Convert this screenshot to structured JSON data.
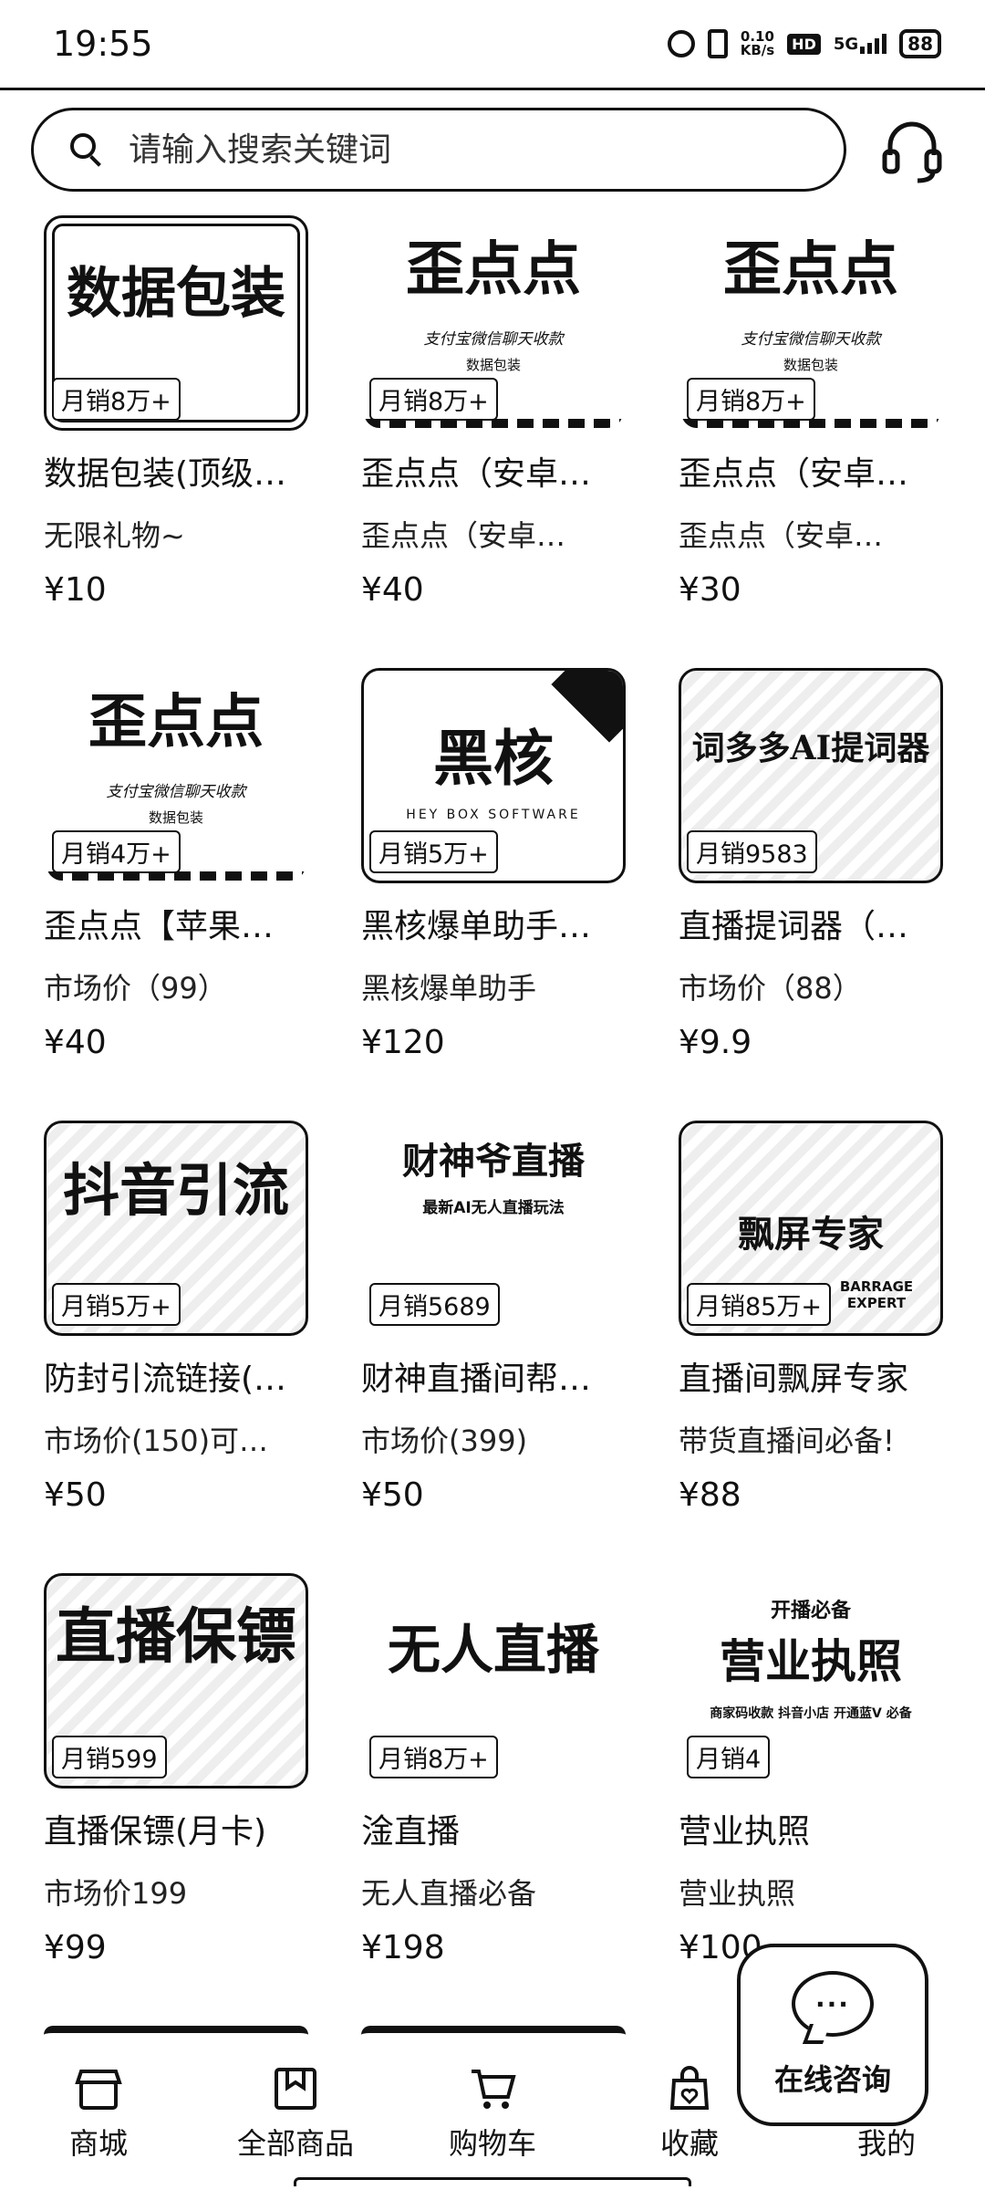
{
  "status_bar": {
    "time": "19:55",
    "net_speed_value": "0.10",
    "net_speed_unit": "KB/s",
    "hd": "HD",
    "signal": "5G",
    "battery": "88"
  },
  "search": {
    "placeholder": "请输入搜索关键词"
  },
  "products": [
    {
      "art": "数据包装",
      "art_sub": "",
      "art_sub2": "",
      "sales": "月销8万+",
      "name": "数据包装(顶级…",
      "desc": "无限礼物~",
      "price": "¥10"
    },
    {
      "art": "歪点点",
      "art_sub": "支付宝微信聊天收款",
      "art_sub2": "数据包装",
      "sales": "月销8万+",
      "name": "歪点点（安卓…",
      "desc": "歪点点（安卓…",
      "price": "¥40"
    },
    {
      "art": "歪点点",
      "art_sub": "支付宝微信聊天收款",
      "art_sub2": "数据包装",
      "sales": "月销8万+",
      "name": "歪点点（安卓…",
      "desc": "歪点点（安卓…",
      "price": "¥30"
    },
    {
      "art": "歪点点",
      "art_sub": "支付宝微信聊天收款",
      "art_sub2": "数据包装",
      "sales": "月销4万+",
      "name": "歪点点【苹果…",
      "desc": "市场价（99）",
      "price": "¥40"
    },
    {
      "art": "黑核",
      "art_sub": "HEY BOX SOFTWARE",
      "art_sub2": "",
      "sales": "月销5万+",
      "name": "黑核爆单助手…",
      "desc": "黑核爆单助手",
      "price": "¥120"
    },
    {
      "art": "词多多AI提词器",
      "art_sub": "",
      "art_sub2": "",
      "sales": "月销9583",
      "name": "直播提词器（…",
      "desc": "市场价（88）",
      "price": "¥9.9"
    },
    {
      "art": "抖音引流",
      "art_sub": "",
      "art_sub2": "",
      "sales": "月销5万+",
      "name": "防封引流链接(…",
      "desc": "市场价(150)可…",
      "price": "¥50"
    },
    {
      "art": "财神爷直播",
      "art_sub": "最新AI无人直播玩法",
      "art_sub2": "",
      "sales": "月销5689",
      "name": "财神直播间帮…",
      "desc": "市场价(399)",
      "price": "¥50"
    },
    {
      "art": "飘屏专家",
      "art_sub": "BARRAGE EXPERT",
      "art_sub2": "",
      "sales": "月销85万+",
      "name": "直播间飘屏专家",
      "desc": "带货直播间必备!",
      "price": "¥88"
    },
    {
      "art": "直播保镖",
      "art_sub": "",
      "art_sub2": "",
      "sales": "月销599",
      "name": "直播保镖(月卡)",
      "desc": "市场价199",
      "price": "¥99"
    },
    {
      "art": "无人直播",
      "art_sub": "",
      "art_sub2": "",
      "sales": "月销8万+",
      "name": "淦直播",
      "desc": "无人直播必备",
      "price": "¥198"
    },
    {
      "art": "营业执照",
      "art_sub": "开播必备",
      "art_sub2": "商家码收款 抖音小店 开通蓝V 必备",
      "sales": "月销4",
      "name": "营业执照",
      "desc": "营业执照",
      "price": "¥100"
    }
  ],
  "chat": {
    "bubble": "···",
    "label": "在线咨询"
  },
  "nav": [
    {
      "label": "商城",
      "icon": "shop-icon"
    },
    {
      "label": "全部商品",
      "icon": "bookmark-box-icon"
    },
    {
      "label": "购物车",
      "icon": "cart-icon"
    },
    {
      "label": "收藏",
      "icon": "favorite-bag-icon"
    },
    {
      "label": "我的",
      "icon": "profile-icon"
    }
  ]
}
